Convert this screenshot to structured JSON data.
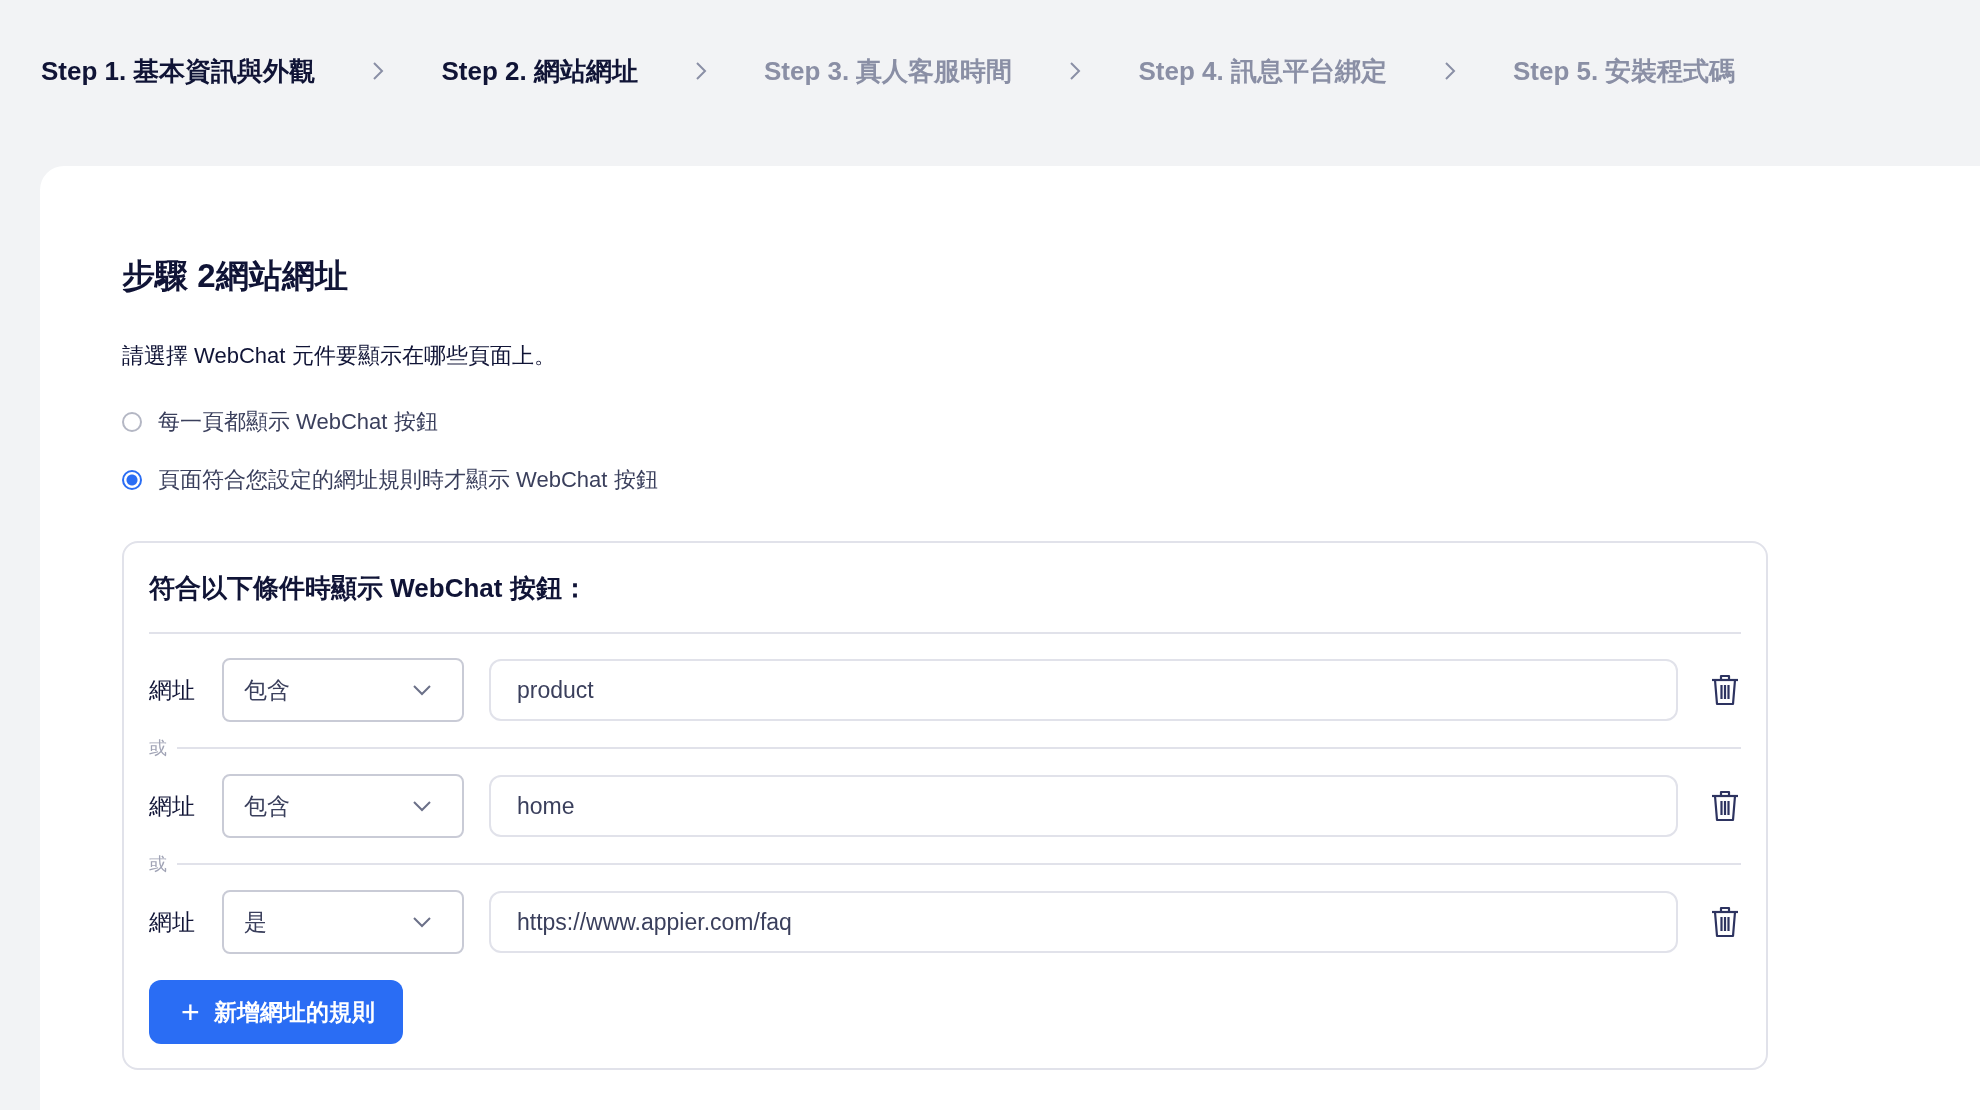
{
  "steps": [
    {
      "label": "Step 1. 基本資訊與外觀",
      "disabled": false
    },
    {
      "label": "Step 2. 網站網址",
      "disabled": false
    },
    {
      "label": "Step 3. 真人客服時間",
      "disabled": true
    },
    {
      "label": "Step 4. 訊息平台綁定",
      "disabled": true
    },
    {
      "label": "Step 5. 安裝程式碼",
      "disabled": true
    }
  ],
  "heading": "步驟 2網站網址",
  "description": "請選擇 WebChat 元件要顯示在哪些頁面上。",
  "options": [
    {
      "label": "每一頁都顯示 WebChat 按鈕",
      "selected": false
    },
    {
      "label": "頁面符合您設定的網址規則時才顯示 WebChat 按鈕",
      "selected": true
    }
  ],
  "rules_panel": {
    "title": "符合以下條件時顯示 WebChat 按鈕：",
    "rules": [
      {
        "label": "網址",
        "operator": "包含",
        "value": "product"
      },
      {
        "label": "網址",
        "operator": "包含",
        "value": "home"
      },
      {
        "label": "網址",
        "operator": "是",
        "value": "https://www.appier.com/faq"
      }
    ],
    "separator": [
      "或",
      "或"
    ],
    "add_button": {
      "icon": "+",
      "label": "新增網址的規則"
    }
  }
}
